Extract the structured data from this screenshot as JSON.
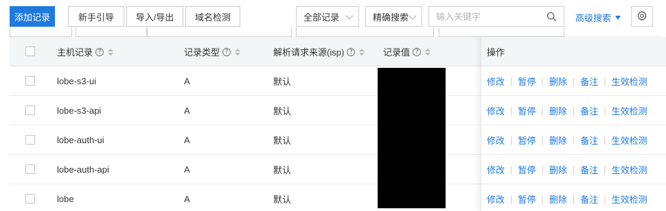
{
  "toolbar": {
    "add_record": "添加记录",
    "guide": "新手引导",
    "import_export": "导入/导出",
    "domain_check": "域名检测",
    "record_filter": "全部记录",
    "search_mode": "精确搜索",
    "search_placeholder": "输入关键字",
    "advanced_search": "高级搜索",
    "icons": {
      "search": "search-icon",
      "settings": "gear-icon",
      "dropdown": "caret-down-icon"
    }
  },
  "table": {
    "headers": {
      "host": "主机记录",
      "type": "记录类型",
      "isp": "解析请求来源(isp)",
      "value": "记录值",
      "actions": "操作"
    },
    "action_labels": [
      "修改",
      "暂停",
      "删除",
      "备注",
      "生效检测"
    ],
    "rows": [
      {
        "host": "lobe-s3-ui",
        "type": "A",
        "isp": "默认"
      },
      {
        "host": "lobe-s3-api",
        "type": "A",
        "isp": "默认"
      },
      {
        "host": "lobe-auth-ui",
        "type": "A",
        "isp": "默认"
      },
      {
        "host": "lobe-auth-api",
        "type": "A",
        "isp": "默认"
      },
      {
        "host": "lobe",
        "type": "A",
        "isp": "默认"
      }
    ]
  },
  "colors": {
    "primary": "#1f7ae0",
    "header_bg": "#f4f5f7",
    "redaction": "#000000"
  }
}
